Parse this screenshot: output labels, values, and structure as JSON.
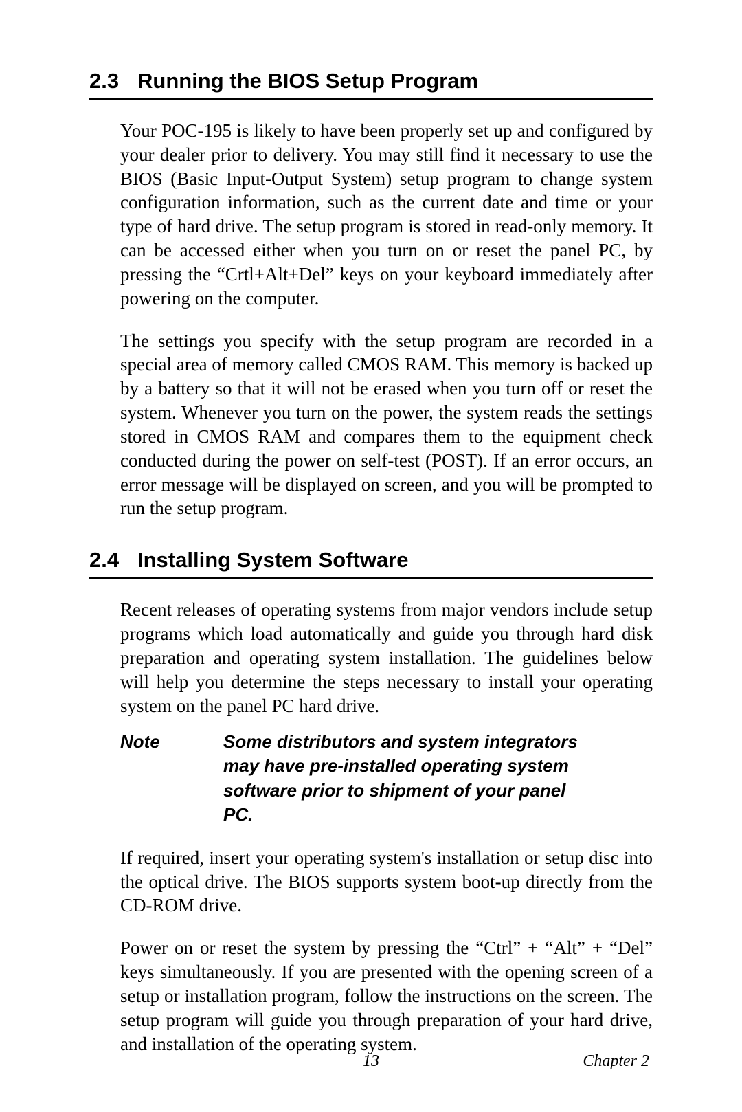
{
  "sections": {
    "s23": {
      "number": "2.3",
      "title": "Running the BIOS Setup Program",
      "p1": "Your POC-195 is likely to have been properly set up and configured by your dealer prior to delivery. You may still find it necessary to use the BIOS (Basic Input-Output System) setup program to change system configuration information, such as the current date and time or your type of hard drive. The setup program is stored in read-only memory. It can be accessed either when you turn on or reset the panel PC, by pressing the “Crtl+Alt+Del” keys on your keyboard immediately after powering on the computer.",
      "p2": "The settings you specify with the setup program are recorded in a special area of memory called CMOS RAM. This memory is backed up by a battery so that it will not be erased when you turn off or reset the system. Whenever you turn on the power, the system reads the settings stored in CMOS RAM and compares them to the equipment check conducted during the power on self-test (POST). If an error occurs, an error message will be displayed on screen, and you will be prompted to run the setup program."
    },
    "s24": {
      "number": "2.4",
      "title": "Installing System Software",
      "p1": "Recent releases of operating systems from major vendors include setup programs which load automatically and guide you through hard disk preparation and operating system installation. The guidelines below will help you determine the steps necessary to install your operating system on the panel PC hard drive.",
      "note_label": "Note",
      "note_text": "Some distributors and system integrators may have pre-installed operating system software prior to shipment of your panel PC.",
      "p2": "If required, insert your operating system's installation or setup disc into the optical drive. The BIOS supports system boot-up directly from the CD-ROM drive.",
      "p3": "Power on or reset the system by pressing the “Ctrl” + “Alt” + “Del” keys simultaneously. If you are presented with the opening screen of a setup or installation program, follow the instructions on the screen. The setup program will guide you through preparation of your hard drive, and installation of the operating system."
    }
  },
  "footer": {
    "page_number": "13",
    "chapter_label": "Chapter 2"
  }
}
